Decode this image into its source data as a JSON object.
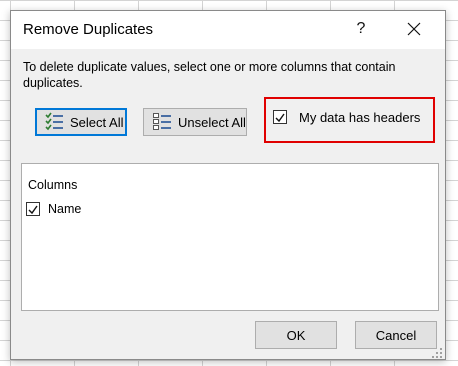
{
  "window": {
    "title": "Remove Duplicates",
    "help_label": "?"
  },
  "instructions": "To delete duplicate values, select one or more columns that contain duplicates.",
  "buttons": {
    "select_all": "Select All",
    "unselect_all": "Unselect All",
    "ok": "OK",
    "cancel": "Cancel"
  },
  "options": {
    "my_data_has_headers": {
      "label": "My data has headers",
      "checked": true
    }
  },
  "columns": {
    "header": "Columns",
    "items": [
      {
        "label": "Name",
        "checked": true
      }
    ]
  },
  "colors": {
    "highlight_border": "#e00000",
    "focus_border": "#0078d7"
  },
  "icons": {
    "select_all": "select-all-list-icon",
    "unselect_all": "unselect-all-list-icon",
    "close": "close-icon"
  }
}
